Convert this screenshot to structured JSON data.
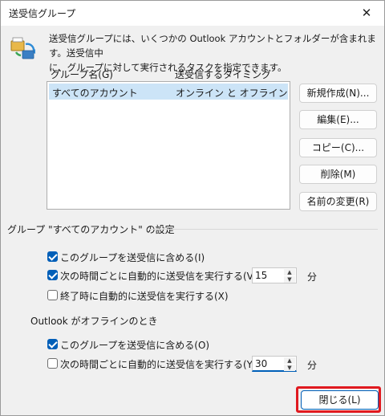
{
  "window": {
    "title": "送受信グループ"
  },
  "description": {
    "line1": "送受信グループには、いくつかの Outlook アカウントとフォルダーが含まれます。送受信中",
    "line2": "に、グループに対して実行されるタスクを指定できます。"
  },
  "list": {
    "headers": [
      "グループ名(G)",
      "送受信するタイミング"
    ],
    "rows": [
      {
        "name": "すべてのアカウント",
        "timing": "オンライン と オフライン",
        "selected": true
      }
    ]
  },
  "buttons": {
    "new": "新規作成(N)...",
    "edit": "編集(E)...",
    "copy": "コピー(C)...",
    "delete": "削除(M)",
    "rename": "名前の変更(R)",
    "close": "閉じる(L)"
  },
  "settings": {
    "title": "グループ \"すべてのアカウント\" の設定",
    "online": {
      "include_label": "このグループを送受信に含める(I)",
      "include_checked": true,
      "schedule_label": "次の時間ごとに自動的に送受信を実行する(V)",
      "schedule_checked": true,
      "schedule_value": "15",
      "unit": "分",
      "on_exit_label": "終了時に自動的に送受信を実行する(X)",
      "on_exit_checked": false
    },
    "offline": {
      "section_label": "Outlook がオフラインのとき",
      "include_label": "このグループを送受信に含める(O)",
      "include_checked": true,
      "schedule_label": "次の時間ごとに自動的に送受信を実行する(Y)",
      "schedule_checked": false,
      "schedule_value": "30",
      "unit": "分"
    }
  },
  "colors": {
    "accent": "#005fb8",
    "selection": "#cce4f7",
    "highlight": "#e0191f"
  }
}
